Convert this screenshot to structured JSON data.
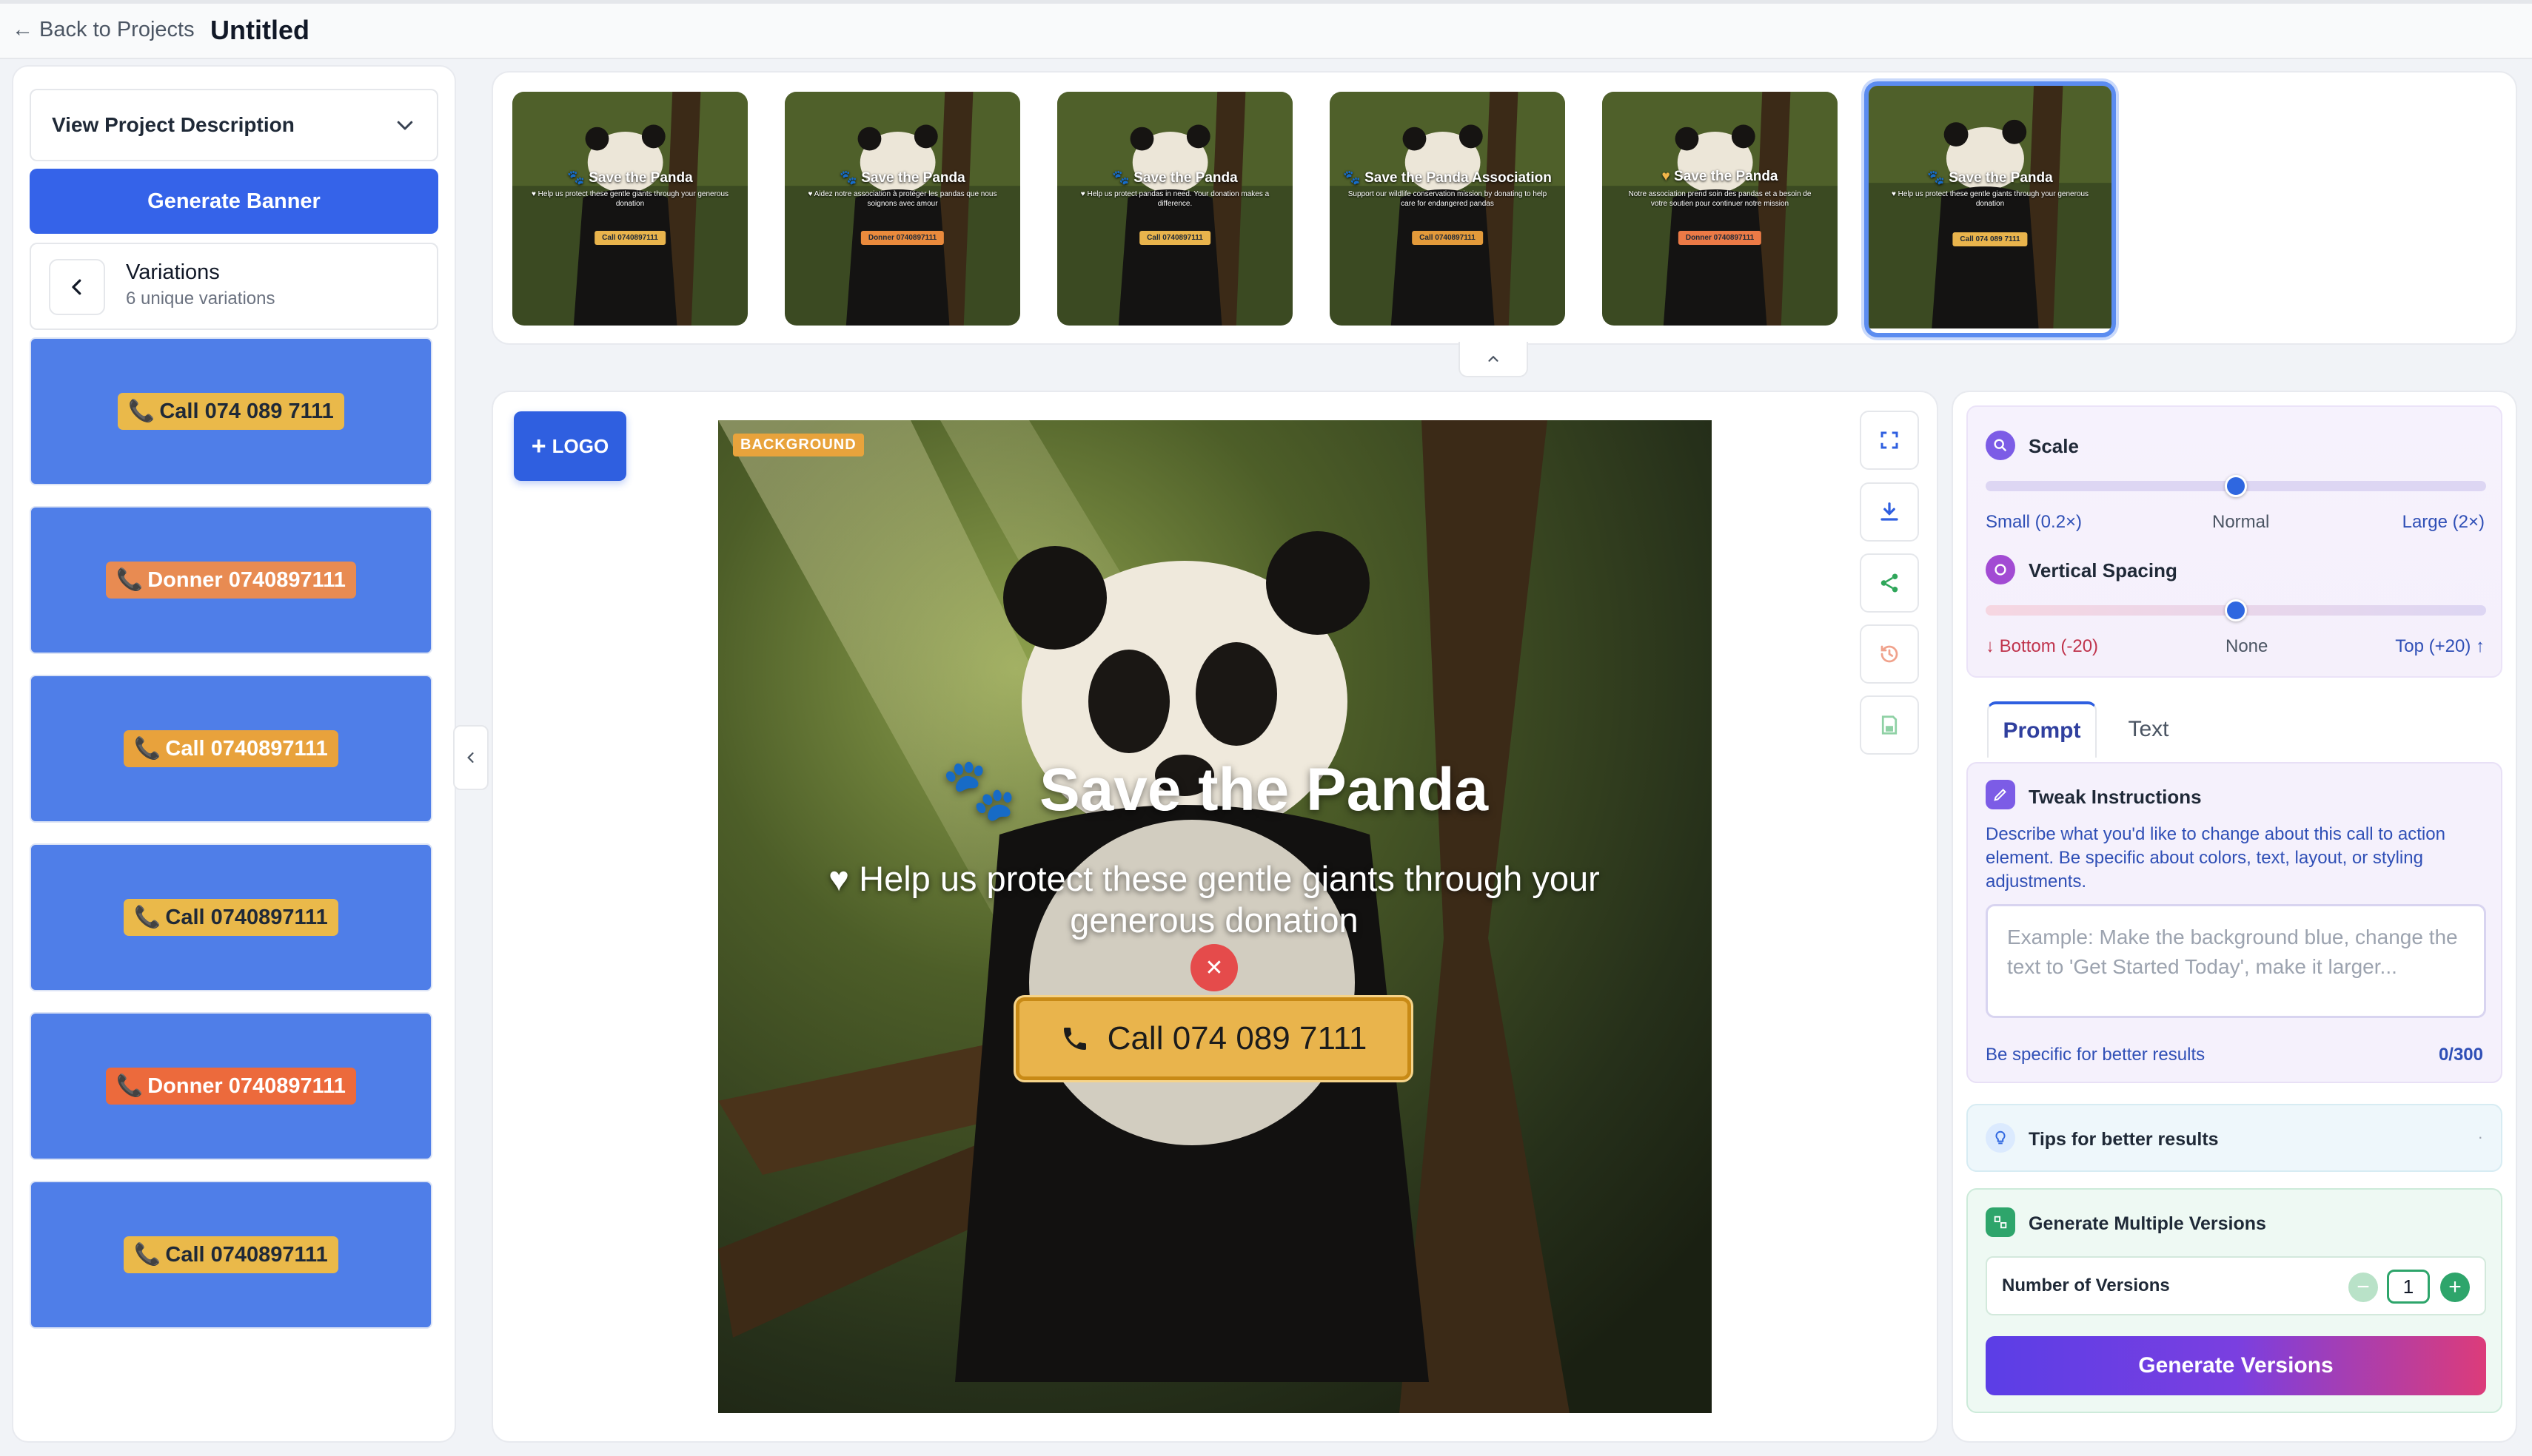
{
  "header": {
    "back_label": "← Back to Projects",
    "project_title": "Untitled"
  },
  "sidebar": {
    "view_description": "View Project Description",
    "generate_banner": "Generate Banner",
    "variations_title": "Variations",
    "variations_subtitle": "6 unique variations",
    "cards": [
      {
        "label": "Call 074 089 7111",
        "style": "yellow"
      },
      {
        "label": "Donner 0740897111",
        "style": "orange"
      },
      {
        "label": "Call 0740897111",
        "style": "amber"
      },
      {
        "label": "Call 0740897111",
        "style": "yellow"
      },
      {
        "label": "Donner 0740897111",
        "style": "red"
      },
      {
        "label": "Call 0740897111",
        "style": "yellow"
      }
    ]
  },
  "thumbnails": [
    {
      "title": "Save the Panda",
      "sub": "♥ Help us protect these gentle giants through your generous donation",
      "cta": "Call 0740897111",
      "cta_color": "#e9b44c",
      "icon": "paw-icon"
    },
    {
      "title": "Save the Panda",
      "sub": "♥ Aidez notre association à protéger les pandas que nous soignons avec amour",
      "cta": "Donner 0740897111",
      "cta_color": "#ea8a3c",
      "icon": "paw-icon"
    },
    {
      "title": "Save the Panda",
      "sub": "♥ Help us protect pandas in need. Your donation makes a difference.",
      "cta": "Call 0740897111",
      "cta_color": "#e9b44c",
      "icon": "paw-icon"
    },
    {
      "title": "Save the Panda Association",
      "sub": "Support our wildlife conservation mission by donating to help care for endangered pandas",
      "cta": "Call 0740897111",
      "cta_color": "#e39a3a",
      "icon": "paw-icon"
    },
    {
      "title": "Save the Panda",
      "sub": "Notre association prend soin des pandas et a besoin de votre soutien pour continuer notre mission",
      "cta": "Donner 0740897111",
      "cta_color": "#ec7a46",
      "icon": "heart-icon"
    },
    {
      "title": "Save the Panda",
      "sub": "♥ Help us protect these gentle giants through your generous donation",
      "cta": "Call 074 089 7111",
      "cta_color": "#e9b44c",
      "icon": "paw-icon"
    }
  ],
  "editor": {
    "logo_button": "LOGO",
    "background_badge": "BACKGROUND",
    "headline": "Save the Panda",
    "subline": "♥ Help us protect these gentle giants through your generous donation",
    "cta": "Call 074 089 7111"
  },
  "controls": {
    "scale": {
      "title": "Scale",
      "min": "Small (0.2×)",
      "mid": "Normal",
      "max": "Large (2×)",
      "value": 0.5
    },
    "vspace": {
      "title": "Vertical Spacing",
      "min": "↓ Bottom (-20)",
      "mid": "None",
      "max": "Top (+20) ↑",
      "value": 0.5
    },
    "tabs": [
      "Prompt",
      "Text"
    ],
    "tweak": {
      "title": "Tweak Instructions",
      "description": "Describe what you'd like to change about this call to action element. Be specific about colors, text, layout, or styling adjustments.",
      "placeholder": "Example: Make the background blue, change the text to 'Get Started Today', make it larger...",
      "hint": "Be specific for better results",
      "counter": "0/300"
    },
    "tips": "Tips for better results",
    "multi": {
      "title": "Generate Multiple Versions",
      "number_label": "Number of Versions",
      "number_value": "1",
      "button": "Generate Versions"
    }
  },
  "colors": {
    "primary": "#3563e9",
    "yellow": "#e9b44c",
    "orange": "#ea8a3c",
    "red": "#ec6a46"
  }
}
